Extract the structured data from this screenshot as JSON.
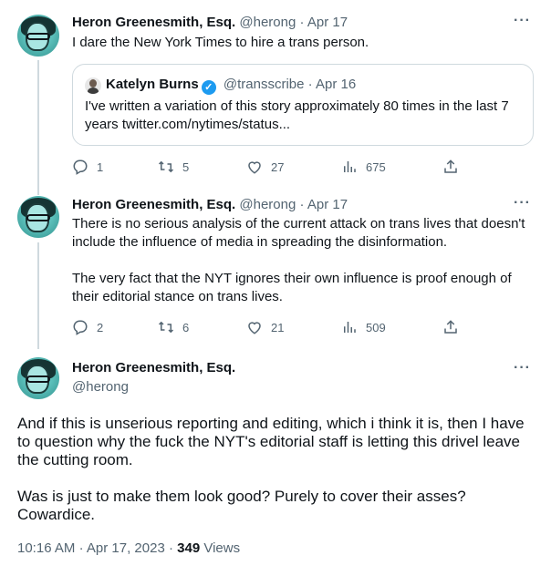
{
  "tweets": [
    {
      "name": "Heron Greenesmith, Esq.",
      "handle": "@herong",
      "sep": "·",
      "date": "Apr 17",
      "text": "I dare the New York Times to hire a trans person.",
      "quote": {
        "name": "Katelyn Burns",
        "handle": "@transscribe",
        "sep": "·",
        "date": "Apr 16",
        "text": "I've written a variation of this story approximately 80 times in the last 7 years twitter.com/nytimes/status..."
      },
      "actions": {
        "replies": "1",
        "retweets": "5",
        "likes": "27",
        "views": "675"
      }
    },
    {
      "name": "Heron Greenesmith, Esq.",
      "handle": "@herong",
      "sep": "·",
      "date": "Apr 17",
      "text_p1": "There is no serious analysis of the current attack on trans lives that doesn't include the influence of media in spreading the disinformation.",
      "text_p2": "The very fact that the NYT ignores their own influence is proof enough of their editorial stance on trans lives.",
      "actions": {
        "replies": "2",
        "retweets": "6",
        "likes": "21",
        "views": "509"
      }
    }
  ],
  "main": {
    "name": "Heron Greenesmith, Esq.",
    "handle": "@herong",
    "text_p1": "And if this is unserious reporting and editing, which i think it is, then I have to question why the fuck the NYT's editorial staff is letting this drivel leave the cutting room.",
    "text_p2": "Was is just to make them look good? Purely to cover their asses? Cowardice.",
    "time": "10:16 AM",
    "sep": "·",
    "date": "Apr 17, 2023",
    "sep2": "·",
    "views_count": "349",
    "views_label": "Views"
  },
  "more_icon": "···",
  "icons": [
    "more-icon",
    "reply-icon",
    "retweet-icon",
    "like-icon",
    "views-icon",
    "share-icon",
    "verified-icon"
  ]
}
